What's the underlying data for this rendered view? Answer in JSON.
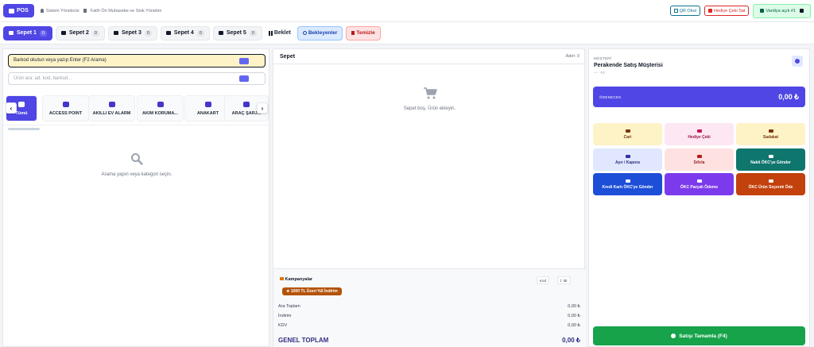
{
  "header": {
    "brand": "POS",
    "user": "Sistem Yöneticisi",
    "branch": "Fatih Ön Muhasebe ve Stok Yönetim",
    "qr_label": "QR Okut",
    "gift_label": "Hediye Çeki Sat",
    "shift_label": "Vardiya açık #1"
  },
  "tabs": [
    {
      "label": "Sepet 1",
      "count": "0"
    },
    {
      "label": "Sepet 2",
      "count": "0"
    },
    {
      "label": "Sepet 3",
      "count": "0"
    },
    {
      "label": "Sepet 4",
      "count": "0"
    },
    {
      "label": "Sepet 5",
      "count": "0"
    }
  ],
  "tab_actions": {
    "hold": "Beklet",
    "waiting": "Bekleyenler",
    "clear": "Temizle"
  },
  "left": {
    "barcode_placeholder": "Barkod okutun veya yazıp Enter (F2 Arama)",
    "search_placeholder": "Ürün ara: ad, kod, barkod...",
    "categories": [
      "Tümü",
      "ACCESS POINT",
      "AKILLI EV ALARM",
      "AKIM KORUMA...",
      "ANAKART",
      "ARAÇ ŞARJ..."
    ],
    "empty_text": "Arama yapın veya kategori seçin."
  },
  "cart": {
    "title": "Sepet",
    "count_label": "Adet: 0",
    "empty_text": "Sepet boş. Ürün ekleyin.",
    "campaigns_title": "Kampanyalar",
    "campaign_badge": "1000 TL Üzeri %5 İndirim",
    "coupon_label": "Kod",
    "discount_label": "İ. ldr",
    "subtotal_label": "Ara Toplam",
    "subtotal": "0,00 ₺",
    "discount_row_label": "İndirim",
    "discount_value": "0,00 ₺",
    "vat_label": "KDV",
    "vat_value": "0,00 ₺",
    "grand_label": "GENEL TOPLAM",
    "grand_value": "0,00 ₺"
  },
  "customer": {
    "label": "MÜŞTERİ",
    "name": "Perakende Satış Müşterisi",
    "sub": "— · P2"
  },
  "payment": {
    "payable_label": "ÖDENECEK",
    "payable_value": "0,00 ₺",
    "actions": [
      "Cari",
      "Hediye Çeki",
      "Sadakat",
      "Ayır / Kapora",
      "Sıfırla",
      "Nakit ÖKC'ye Gönder",
      "Kredi Kartı ÖKC'ye Gönder",
      "ÖKC Parçalı Ödeme",
      "ÖKC Ürün Seçerek Öde"
    ],
    "complete_label": "Satışı Tamamla (F4)"
  },
  "colors": {
    "primary": "#4f46e5",
    "success": "#16a34a",
    "danger": "#dc2626"
  }
}
